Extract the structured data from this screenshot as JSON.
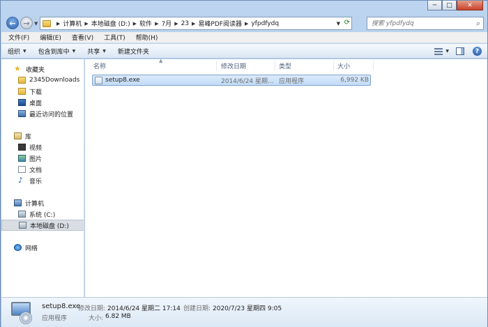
{
  "window": {
    "controls": {
      "minimize": "─",
      "maximize": "□",
      "close": "✕"
    }
  },
  "address": {
    "breadcrumbs": [
      "计算机",
      "本地磁盘 (D:)",
      "软件",
      "7月",
      "23",
      "易峰PDF阅读器",
      "yfpdfydq"
    ],
    "search_placeholder": "搜索 yfpdfydq"
  },
  "menu": [
    "文件(F)",
    "编辑(E)",
    "查看(V)",
    "工具(T)",
    "帮助(H)"
  ],
  "toolbar": {
    "organize": "组织",
    "include_library": "包含到库中",
    "share": "共享",
    "new_folder": "新建文件夹"
  },
  "nav": {
    "favorites": {
      "label": "收藏夹",
      "items": [
        "2345Downloads",
        "下载",
        "桌面",
        "最近访问的位置"
      ]
    },
    "libraries": {
      "label": "库",
      "items": [
        "视频",
        "图片",
        "文档",
        "音乐"
      ]
    },
    "computer": {
      "label": "计算机",
      "items": [
        "系统 (C:)",
        "本地磁盘 (D:)"
      ]
    },
    "network": {
      "label": "网络"
    }
  },
  "columns": {
    "name": "名称",
    "modified": "修改日期",
    "type": "类型",
    "size": "大小"
  },
  "files": [
    {
      "name": "setup8.exe",
      "modified": "2014/6/24 星期...",
      "type": "应用程序",
      "size": "6,992 KB"
    }
  ],
  "details": {
    "filename": "setup8.exe",
    "modified_label": "修改日期:",
    "modified": "2014/6/24 星期二 17:14",
    "created_label": "创建日期:",
    "created": "2020/7/23 星期四 9:05",
    "type": "应用程序",
    "size_label": "大小:",
    "size": "6.82 MB"
  }
}
